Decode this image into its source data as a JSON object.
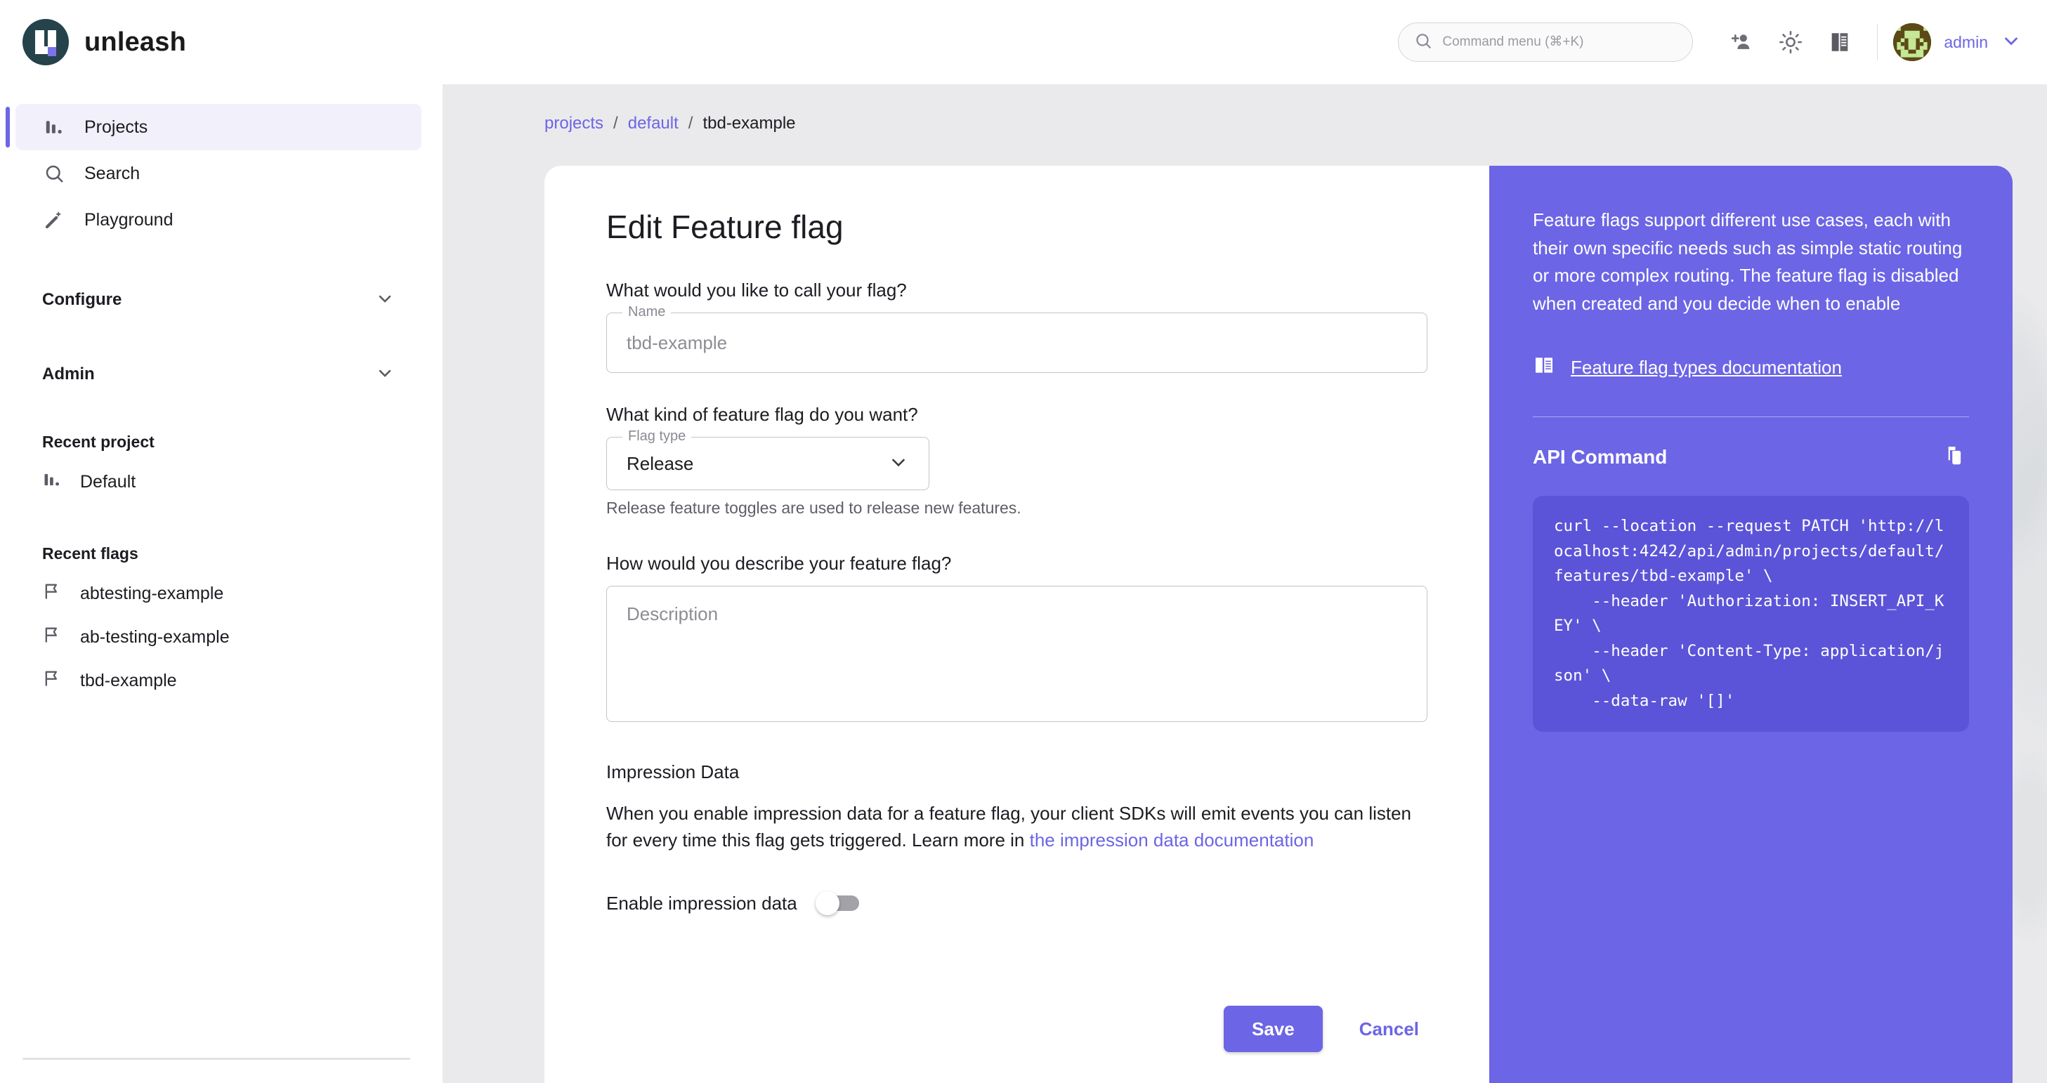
{
  "header": {
    "brand_name": "unleash",
    "logo_icon": "unleash-logo-icon",
    "search": {
      "placeholder": "Command menu (⌘+K)",
      "value": "",
      "icon": "search-icon"
    },
    "icons": [
      {
        "name": "add-user-icon",
        "label": "Invite users"
      },
      {
        "name": "theme-toggle-icon",
        "label": "Toggle theme"
      },
      {
        "name": "documentation-icon",
        "label": "Documentation"
      }
    ],
    "user": {
      "name": "admin",
      "avatar_icon": "avatar",
      "chevron_icon": "chevron-down-icon"
    }
  },
  "sidebar": {
    "primary": [
      {
        "label": "Projects",
        "icon": "projects-icon",
        "active": true
      },
      {
        "label": "Search",
        "icon": "search-icon",
        "active": false
      },
      {
        "label": "Playground",
        "icon": "playground-icon",
        "active": false
      }
    ],
    "groups": [
      {
        "label": "Configure",
        "chevron": "chevron-down-icon"
      },
      {
        "label": "Admin",
        "chevron": "chevron-down-icon"
      }
    ],
    "recent_project_title": "Recent project",
    "recent_projects": [
      {
        "label": "Default",
        "icon": "projects-icon"
      }
    ],
    "recent_flags_title": "Recent flags",
    "recent_flags": [
      {
        "label": "abtesting-example",
        "icon": "flag-icon"
      },
      {
        "label": "ab-testing-example",
        "icon": "flag-icon"
      },
      {
        "label": "tbd-example",
        "icon": "flag-icon"
      }
    ]
  },
  "breadcrumb": {
    "item1": "projects",
    "sep1": "/",
    "item2": "default",
    "sep2": "/",
    "current": "tbd-example"
  },
  "form": {
    "title": "Edit Feature flag",
    "name_question": "What would you like to call your flag?",
    "name_label": "Name",
    "name_value": "tbd-example",
    "type_question": "What kind of feature flag do you want?",
    "type_label": "Flag type",
    "type_value": "Release",
    "type_chevron": "chevron-down-icon",
    "type_helper": "Release feature toggles are used to release new features.",
    "description_question": "How would you describe your feature flag?",
    "description_placeholder": "Description",
    "description_value": "",
    "impression_title": "Impression Data",
    "impression_text_before": "When you enable impression data for a feature flag, your client SDKs will emit events you can listen for every time this flag gets triggered. Learn more in ",
    "impression_link": "the impression data documentation",
    "impression_toggle_label": "Enable impression data",
    "impression_toggle_state": "off",
    "save_label": "Save",
    "cancel_label": "Cancel"
  },
  "side_panel": {
    "description": "Feature flags support different use cases, each with their own specific needs such as simple static routing or more complex routing. The feature flag is disabled when created and you decide when to enable",
    "doc_link": "Feature flag types documentation",
    "doc_link_icon": "book-icon",
    "api_title": "API Command",
    "copy_icon": "copy-icon",
    "api_command": "curl --location --request PATCH 'http://localhost:4242/api/admin/projects/default/features/tbd-example' \\\n    --header 'Authorization: INSERT_API_KEY' \\\n    --header 'Content-Type: application/json' \\\n    --data-raw '[]'"
  },
  "colors": {
    "accent": "#6C65E5",
    "accent_dark": "#5B54D8",
    "brand_dark": "#26424B",
    "page_bg": "#EAEAEC"
  }
}
